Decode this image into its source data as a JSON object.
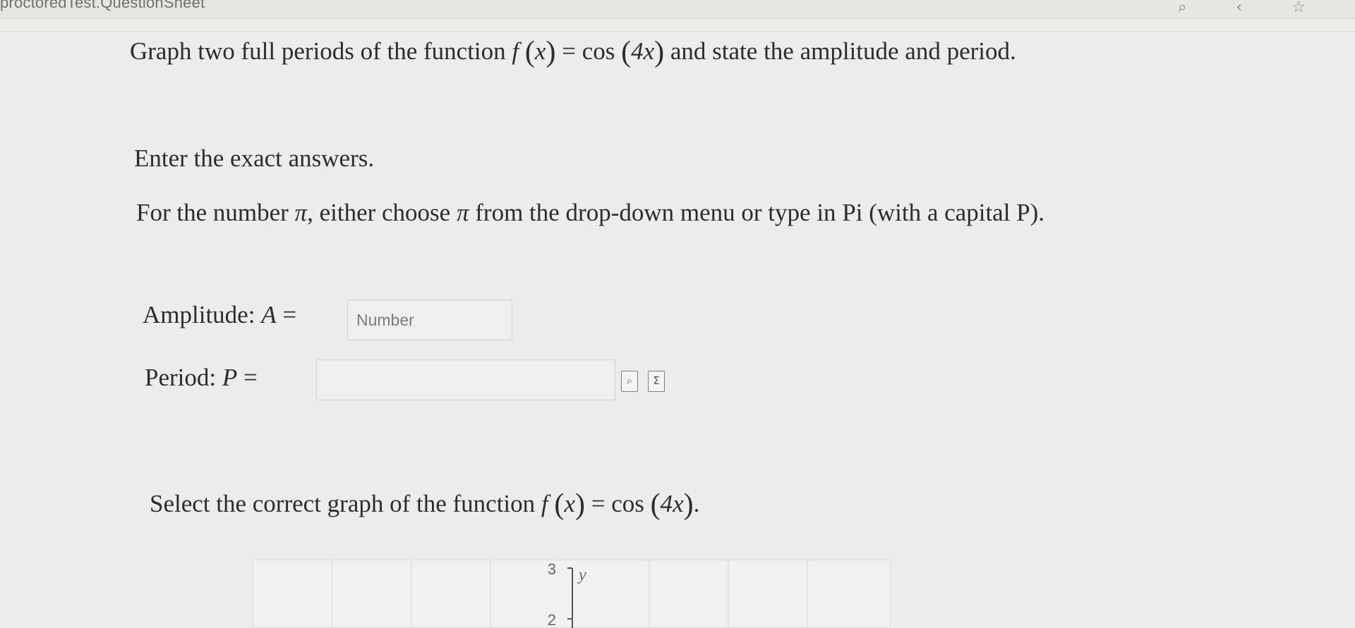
{
  "window": {
    "title": "proctoredTest.QuestionSheet",
    "icons": [
      "search-icon",
      "back-icon",
      "star-icon"
    ]
  },
  "question": {
    "prefix": "Graph two full periods of the function",
    "function_name": "f",
    "variable": "x",
    "equals": "=",
    "cos": "cos",
    "argument": "4x",
    "suffix": "and state the amplitude and period."
  },
  "instructions": {
    "exact": "Enter the exact answers.",
    "pi_prefix": "For the number",
    "pi_symbol": "π",
    "pi_middle": ", either choose",
    "pi_suffix": "from the drop-down menu or type in Pi (with a capital P)."
  },
  "amplitude": {
    "label": "Amplitude:",
    "variable": "A",
    "equals": "=",
    "placeholder": "Number",
    "value": ""
  },
  "period": {
    "label": "Period:",
    "variable": "P",
    "equals": "=",
    "value": ""
  },
  "period_tools": {
    "preview_icon": "preview-icon",
    "sigma_icon": "sigma-icon"
  },
  "graph_section": {
    "prompt_prefix": "Select the correct graph of the function",
    "function_name": "f",
    "variable": "x",
    "equals": "=",
    "cos": "cos",
    "argument": "4x",
    "period_end": "."
  },
  "chart_data": {
    "type": "line",
    "ylabel": "y",
    "y_ticks": [
      "3",
      "2"
    ],
    "series": []
  }
}
